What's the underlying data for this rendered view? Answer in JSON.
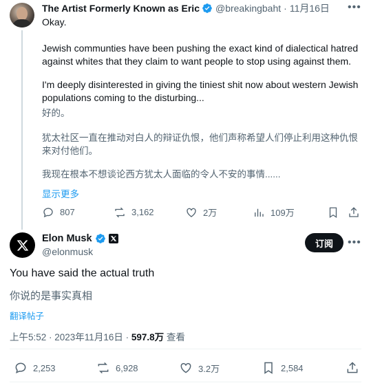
{
  "reply": {
    "author_name": "The Artist Formerly Known as Eric",
    "handle": "@breakingbaht",
    "separator": "·",
    "date": "11月16日",
    "text_1": "Okay.",
    "text_2": "Jewish communties have been pushing the exact kind of dialectical hatred against whites that they claim to want people to stop using against them.",
    "text_3": "I'm deeply disinterested in giving the tiniest shit now about western Jewish populations coming to the disturbing...",
    "trans_1": "好的。",
    "trans_2": "犹太社区一直在推动对白人的辩证仇恨，他们声称希望人们停止利用这种仇恨来对付他们。",
    "trans_3": "我现在根本不想谈论西方犹太人面临的令人不安的事情......",
    "show_more": "显示更多",
    "stats": {
      "replies": "807",
      "reposts": "3,162",
      "likes": "2万",
      "views": "109万"
    }
  },
  "main_post": {
    "author_name": "Elon Musk",
    "handle": "@elonmusk",
    "follow_label": "订阅",
    "text": "You have said the actual truth",
    "translation": "你说的是事实真相",
    "translate_link": "翻译帖子",
    "timestamp": "上午5:52 · 2023年11月16日 ·",
    "views_count": "597.8万",
    "views_label": "查看",
    "stats": {
      "replies": "2,253",
      "reposts": "6,928",
      "likes": "3.2万",
      "bookmarks": "2,584"
    }
  },
  "colors": {
    "accent": "#1d9bf0",
    "secondary_text": "#536471",
    "primary_text": "#0f1419"
  }
}
